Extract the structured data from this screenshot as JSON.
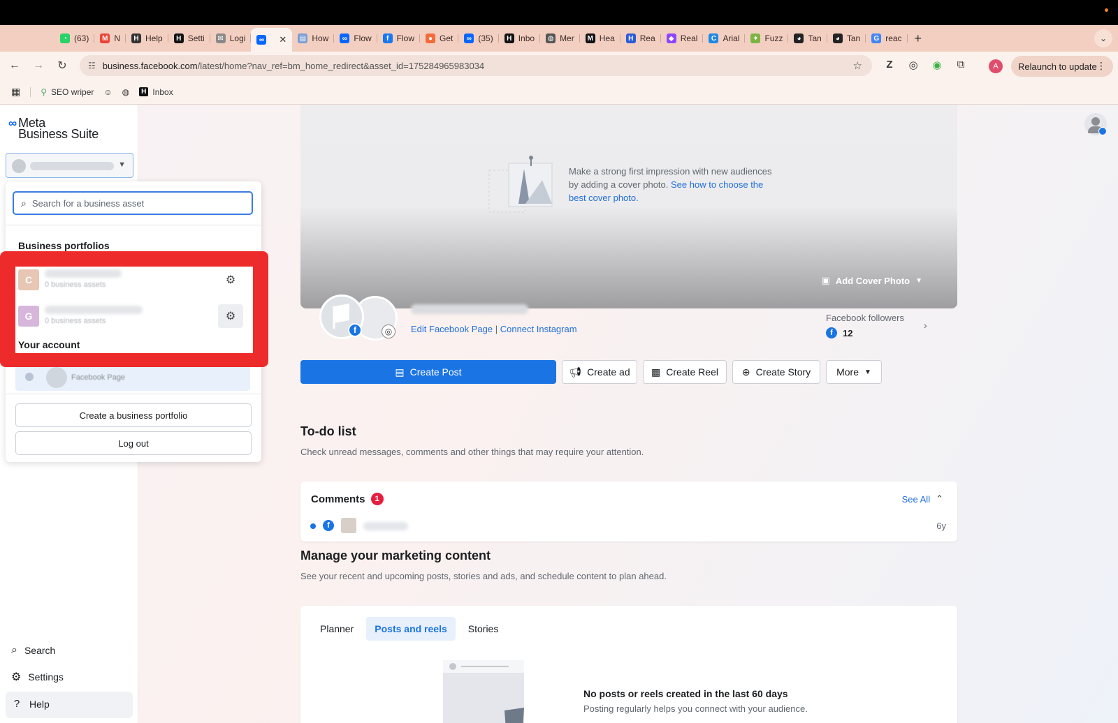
{
  "browser": {
    "tabs": [
      {
        "label": "(63)",
        "icon": "whatsapp-icon",
        "color": "#25d366"
      },
      {
        "label": "N",
        "icon": "gmail-icon",
        "color": "#ea4335"
      },
      {
        "label": "Help",
        "icon": "h-icon",
        "color": "#333333"
      },
      {
        "label": "Setti",
        "icon": "h-icon",
        "color": "#111111"
      },
      {
        "label": "Logi",
        "icon": "mail-icon",
        "color": "#8a8a8a"
      },
      {
        "label": "",
        "icon": "meta-icon",
        "color": "#0866ff",
        "active": true
      },
      {
        "label": "How",
        "icon": "doc-icon",
        "color": "#7a9cd3"
      },
      {
        "label": "Flow",
        "icon": "meta-icon",
        "color": "#0866ff"
      },
      {
        "label": "Flow",
        "icon": "facebook-icon",
        "color": "#1877f2"
      },
      {
        "label": "Get",
        "icon": "circle-icon",
        "color": "#f26b3a"
      },
      {
        "label": "(35)",
        "icon": "meta-icon",
        "color": "#0866ff"
      },
      {
        "label": "Inbo",
        "icon": "h-icon",
        "color": "#111111"
      },
      {
        "label": "Mer",
        "icon": "globe-icon",
        "color": "#555555"
      },
      {
        "label": "Hea",
        "icon": "m-icon",
        "color": "#111111"
      },
      {
        "label": "Rea",
        "icon": "h-icon",
        "color": "#2c5bd6"
      },
      {
        "label": "Real",
        "icon": "framer-icon",
        "color": "#8e44ff"
      },
      {
        "label": "Arial",
        "icon": "c-icon",
        "color": "#1e88e5"
      },
      {
        "label": "Fuzz",
        "icon": "bird-icon",
        "color": "#7cb342"
      },
      {
        "label": "Tan",
        "icon": "github-icon",
        "color": "#222222"
      },
      {
        "label": "Tan",
        "icon": "github-icon",
        "color": "#222222"
      },
      {
        "label": "reac",
        "icon": "google-icon",
        "color": "#4285f4"
      }
    ],
    "url_host": "business.facebook.com",
    "url_path": "/latest/home?nav_ref=bm_home_redirect&asset_id=175284965983034",
    "relaunch_label": "Relaunch to update",
    "profile_initial": "A",
    "bookmarks": [
      {
        "label": "SEO wriper"
      },
      {
        "label": ""
      },
      {
        "label": ""
      },
      {
        "label": "Inbox"
      }
    ]
  },
  "sidebar": {
    "logo_line1": "Meta",
    "logo_line2": "Business Suite",
    "bottom": {
      "search": "Search",
      "settings": "Settings",
      "help": "Help"
    }
  },
  "dropdown": {
    "search_placeholder": "Search for a business asset",
    "heading": "Business portfolios",
    "portfolios": [
      {
        "initial": "C",
        "sub": "0 business assets",
        "color": "#e8c6b4"
      },
      {
        "initial": "G",
        "sub": "0 business assets",
        "color": "#d7b6dc"
      }
    ],
    "your_account": "Your account",
    "account_sub": "Facebook Page",
    "create_portfolio": "Create a business portfolio",
    "log_out": "Log out"
  },
  "cover": {
    "text": "Make a strong first impression with new audiences by adding a cover photo. ",
    "link": "See how to choose the best cover photo.",
    "add_cover": "Add Cover Photo"
  },
  "page_header": {
    "edit_link": "Edit Facebook Page",
    "separator": "|",
    "connect_link": "Connect Instagram",
    "followers_label": "Facebook followers",
    "followers_count": "12"
  },
  "actions": {
    "create_post": "Create Post",
    "create_ad": "Create ad",
    "create_reel": "Create Reel",
    "create_story": "Create Story",
    "more": "More"
  },
  "todo": {
    "title": "To-do list",
    "subtitle": "Check unread messages, comments and other things that may require your attention.",
    "comments_title": "Comments",
    "comments_count": "1",
    "see_all": "See All",
    "comment_time": "6y"
  },
  "marketing": {
    "title": "Manage your marketing content",
    "subtitle": "See your recent and upcoming posts, stories and ads, and schedule content to plan ahead.",
    "tabs": [
      "Planner",
      "Posts and reels",
      "Stories"
    ],
    "active_tab": "Posts and reels",
    "empty_title": "No posts or reels created in the last 60 days",
    "empty_sub": "Posting regularly helps you connect with your audience."
  },
  "colors": {
    "accent": "#1b74e4",
    "highlight": "#ee2b2b",
    "badge": "#e41e3f"
  }
}
